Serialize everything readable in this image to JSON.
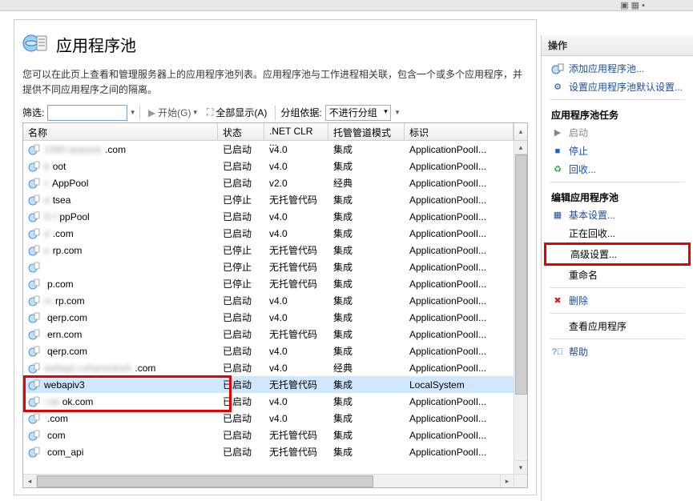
{
  "heading": "应用程序池",
  "description": "您可以在此页上查看和管理服务器上的应用程序池列表。应用程序池与工作进程相关联，包含一个或多个应用程序，并提供不同应用程序之间的隔离。",
  "toolbar": {
    "filter_label": "筛选:",
    "start_label": "开始(G)",
    "showall_label": "全部显示(A)",
    "groupby_label": "分组依据:",
    "groupby_value": "不进行分组"
  },
  "columns": {
    "name": "名称",
    "status": "状态",
    "clr": ".NET CLR ...",
    "mode": "托管管道模式",
    "ident": "标识"
  },
  "rows": [
    {
      "name_blur": "1090 iatatook",
      "name": ".com",
      "status": "已启动",
      "clr": "v4.0",
      "mode": "集成",
      "ident": "ApplicationPoolI..."
    },
    {
      "name_blur": "b",
      "name": "oot",
      "status": "已启动",
      "clr": "v4.0",
      "mode": "集成",
      "ident": "ApplicationPoolI..."
    },
    {
      "name_blur": "c",
      "name": " AppPool",
      "status": "已启动",
      "clr": "v2.0",
      "mode": "经典",
      "ident": "ApplicationPoolI..."
    },
    {
      "name_blur": "d",
      "name": "tsea",
      "status": "已停止",
      "clr": "无托管代码",
      "mode": "集成",
      "ident": "ApplicationPoolI..."
    },
    {
      "name_blur": "D f",
      "name": "ppPool",
      "status": "已启动",
      "clr": "v4.0",
      "mode": "集成",
      "ident": "ApplicationPoolI..."
    },
    {
      "name_blur": "d",
      "name": ".com",
      "status": "已启动",
      "clr": "v4.0",
      "mode": "集成",
      "ident": "ApplicationPoolI..."
    },
    {
      "name_blur": "e",
      "name": "rp.com",
      "status": "已停止",
      "clr": "无托管代码",
      "mode": "集成",
      "ident": "ApplicationPoolI..."
    },
    {
      "name_blur": "",
      "name": "",
      "status": "已停止",
      "clr": "无托管代码",
      "mode": "集成",
      "ident": "ApplicationPoolI..."
    },
    {
      "name_blur": "",
      "name": "p.com",
      "status": "已停止",
      "clr": "无托管代码",
      "mode": "集成",
      "ident": "ApplicationPoolI..."
    },
    {
      "name_blur": "m",
      "name": "rp.com",
      "status": "已启动",
      "clr": "v4.0",
      "mode": "集成",
      "ident": "ApplicationPoolI..."
    },
    {
      "name_blur": "",
      "name": "qerp.com",
      "status": "已启动",
      "clr": "v4.0",
      "mode": "集成",
      "ident": "ApplicationPoolI..."
    },
    {
      "name_blur": "",
      "name": "ern.com",
      "status": "已启动",
      "clr": "无托管代码",
      "mode": "集成",
      "ident": "ApplicationPoolI..."
    },
    {
      "name_blur": "",
      "name": "qerp.com",
      "status": "已启动",
      "clr": "v4.0",
      "mode": "集成",
      "ident": "ApplicationPoolI..."
    },
    {
      "name_blur": "webapi.csframework",
      "name": ".com",
      "status": "已启动",
      "clr": "v4.0",
      "mode": "经典",
      "ident": "ApplicationPoolI..."
    },
    {
      "name": "webapiv3",
      "status": "已启动",
      "clr": "无托管代码",
      "mode": "集成",
      "ident": "LocalSystem",
      "selected": true,
      "hl": true
    },
    {
      "name_blur": "i lat",
      "name": "ok.com",
      "status": "已启动",
      "clr": "v4.0",
      "mode": "集成",
      "ident": "ApplicationPoolI..."
    },
    {
      "name_blur": "",
      "name": ".com",
      "status": "已启动",
      "clr": "v4.0",
      "mode": "集成",
      "ident": "ApplicationPoolI..."
    },
    {
      "name_blur": "",
      "name": "com",
      "status": "已启动",
      "clr": "无托管代码",
      "mode": "集成",
      "ident": "ApplicationPoolI..."
    },
    {
      "name_blur": "",
      "name": "com_api",
      "status": "已启动",
      "clr": "无托管代码",
      "mode": "集成",
      "ident": "ApplicationPoolI..."
    }
  ],
  "actions": {
    "title": "操作",
    "add_pool": "添加应用程序池...",
    "set_default": "设置应用程序池默认设置...",
    "section_tasks": "应用程序池任务",
    "start": "启动",
    "stop": "停止",
    "recycle": "回收...",
    "section_edit": "编辑应用程序池",
    "basic": "基本设置...",
    "recycling": "正在回收...",
    "advanced": "高级设置...",
    "rename": "重命名",
    "delete": "删除",
    "view_apps": "查看应用程序",
    "help": "帮助"
  }
}
